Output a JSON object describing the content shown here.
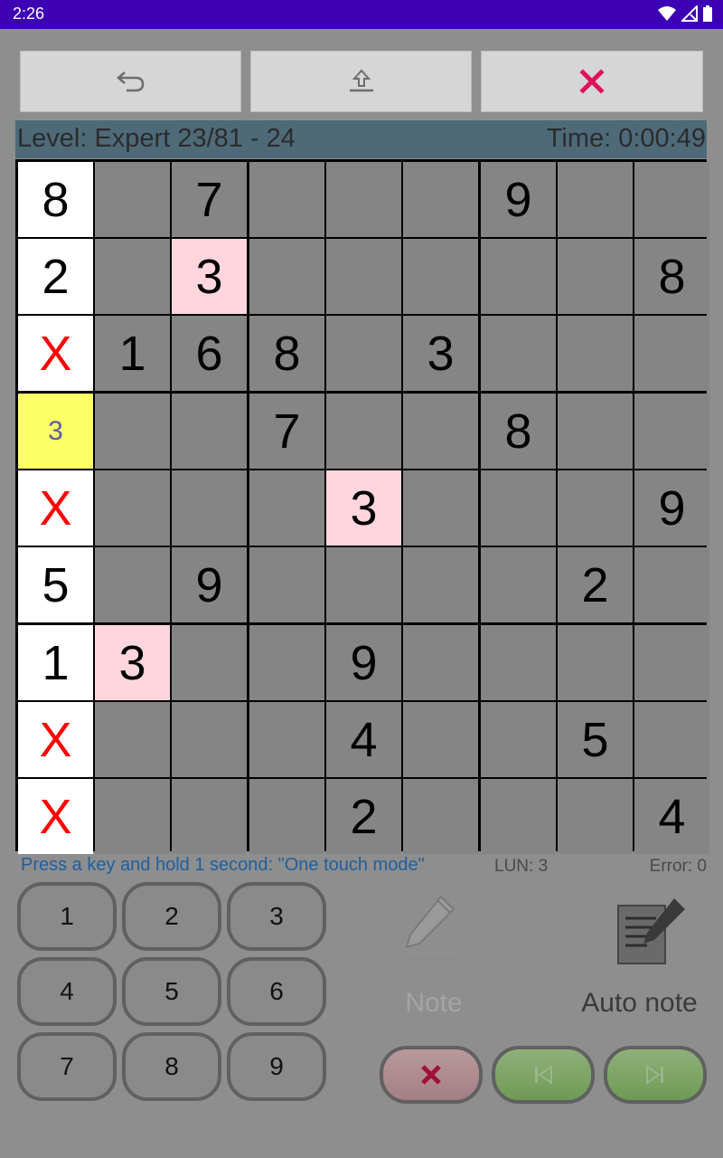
{
  "status_bar": {
    "time": "2:26"
  },
  "toolbar": {
    "undo_icon": "undo-arrow-icon",
    "share_icon": "upload-icon",
    "close_icon": "close-x-icon",
    "close_color": "#e0105a"
  },
  "info": {
    "level": "Level: Expert 23/81 - 24",
    "time": "Time: 0:00:49"
  },
  "board": {
    "rows": [
      [
        "8",
        "",
        "7",
        "",
        "",
        "",
        "9",
        "",
        ""
      ],
      [
        "2",
        "",
        "3",
        "",
        "",
        "",
        "",
        "",
        "8"
      ],
      [
        "X",
        "1",
        "6",
        "8",
        "",
        "3",
        "",
        "",
        ""
      ],
      [
        "3",
        "",
        "",
        "7",
        "",
        "",
        "8",
        "",
        ""
      ],
      [
        "X",
        "",
        "",
        "",
        "3",
        "",
        "",
        "",
        "9"
      ],
      [
        "5",
        "",
        "9",
        "",
        "",
        "",
        "",
        "2",
        ""
      ],
      [
        "1",
        "3",
        "",
        "",
        "9",
        "",
        "",
        "",
        ""
      ],
      [
        "X",
        "",
        "",
        "",
        "4",
        "",
        "",
        "5",
        ""
      ],
      [
        "X",
        "",
        "",
        "",
        "2",
        "",
        "",
        "",
        "4"
      ]
    ],
    "highlights": {
      "white_column": 0,
      "pink_cells": [
        [
          1,
          2
        ],
        [
          4,
          4
        ],
        [
          6,
          1
        ]
      ],
      "yellow_cells": [
        [
          3,
          0
        ]
      ]
    },
    "colors": {
      "cell": "#858585",
      "white": "#ffffff",
      "pink": "#ffd6de",
      "yellow": "#ffff66",
      "x": "#ff0000"
    }
  },
  "hint": {
    "text": "Press a key and hold 1 second: \"One touch mode\"",
    "lun": "LUN: 3",
    "error": "Error: 0"
  },
  "keypad": [
    "1",
    "2",
    "3",
    "4",
    "5",
    "6",
    "7",
    "8",
    "9"
  ],
  "note": {
    "label": "Note",
    "icon": "pencil-icon"
  },
  "auto_note": {
    "label": "Auto note",
    "icon": "notepad-pencil-icon"
  },
  "bottom_buttons": {
    "clear_icon": "clear-x-icon",
    "prev_icon": "skip-previous-icon",
    "next_icon": "skip-next-icon"
  }
}
